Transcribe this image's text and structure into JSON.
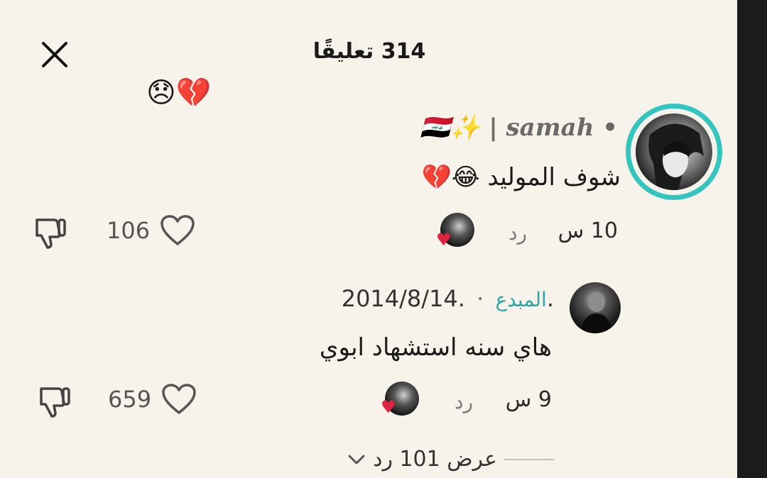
{
  "header": {
    "title": "314 تعليقًا"
  },
  "previous_comment": {
    "emoji": "😞💔"
  },
  "comments": [
    {
      "username": "🇮🇶✨ | samah •",
      "text": "شوف المولید 😂💔",
      "time": "10 س",
      "reply_label": "رد",
      "likes": "106"
    }
  ],
  "replies": [
    {
      "author": ".2014/8/14.",
      "badge": "المبدع",
      "separator": "·",
      "text": "هاي سنه استشهاد ابوي",
      "time": "9 س",
      "reply_label": "رد",
      "likes": "659"
    }
  ],
  "view_replies": {
    "label": "عرض 101 رد"
  },
  "colors": {
    "background": "#f7f2ea",
    "accent_ring": "#33c6c0",
    "creator_badge": "#2aa7a8",
    "heart_red": "#e0243f"
  },
  "icons": [
    "close-icon",
    "heart-icon",
    "thumbs-down-icon",
    "chevron-down-icon"
  ]
}
